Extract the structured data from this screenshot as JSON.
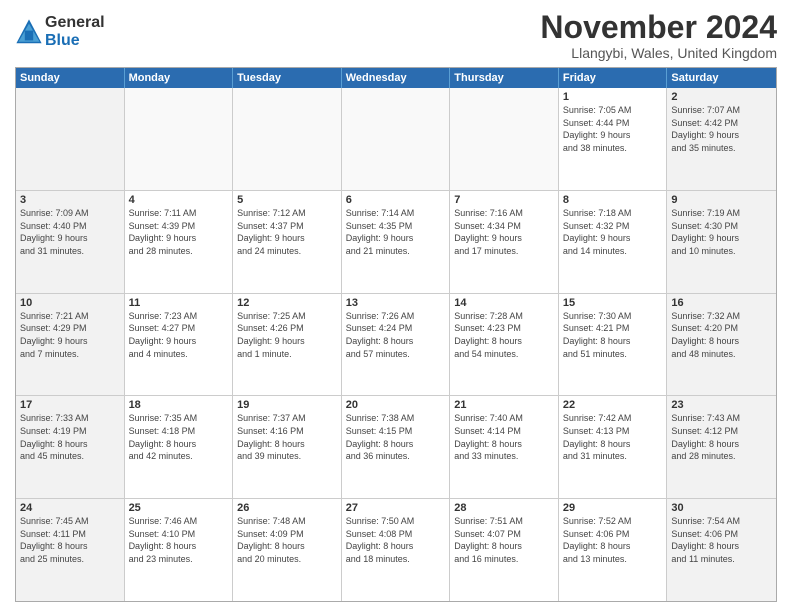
{
  "logo": {
    "general": "General",
    "blue": "Blue"
  },
  "title": "November 2024",
  "location": "Llangybi, Wales, United Kingdom",
  "header_days": [
    "Sunday",
    "Monday",
    "Tuesday",
    "Wednesday",
    "Thursday",
    "Friday",
    "Saturday"
  ],
  "weeks": [
    [
      {
        "day": "",
        "info": ""
      },
      {
        "day": "",
        "info": ""
      },
      {
        "day": "",
        "info": ""
      },
      {
        "day": "",
        "info": ""
      },
      {
        "day": "",
        "info": ""
      },
      {
        "day": "1",
        "info": "Sunrise: 7:05 AM\nSunset: 4:44 PM\nDaylight: 9 hours\nand 38 minutes."
      },
      {
        "day": "2",
        "info": "Sunrise: 7:07 AM\nSunset: 4:42 PM\nDaylight: 9 hours\nand 35 minutes."
      }
    ],
    [
      {
        "day": "3",
        "info": "Sunrise: 7:09 AM\nSunset: 4:40 PM\nDaylight: 9 hours\nand 31 minutes."
      },
      {
        "day": "4",
        "info": "Sunrise: 7:11 AM\nSunset: 4:39 PM\nDaylight: 9 hours\nand 28 minutes."
      },
      {
        "day": "5",
        "info": "Sunrise: 7:12 AM\nSunset: 4:37 PM\nDaylight: 9 hours\nand 24 minutes."
      },
      {
        "day": "6",
        "info": "Sunrise: 7:14 AM\nSunset: 4:35 PM\nDaylight: 9 hours\nand 21 minutes."
      },
      {
        "day": "7",
        "info": "Sunrise: 7:16 AM\nSunset: 4:34 PM\nDaylight: 9 hours\nand 17 minutes."
      },
      {
        "day": "8",
        "info": "Sunrise: 7:18 AM\nSunset: 4:32 PM\nDaylight: 9 hours\nand 14 minutes."
      },
      {
        "day": "9",
        "info": "Sunrise: 7:19 AM\nSunset: 4:30 PM\nDaylight: 9 hours\nand 10 minutes."
      }
    ],
    [
      {
        "day": "10",
        "info": "Sunrise: 7:21 AM\nSunset: 4:29 PM\nDaylight: 9 hours\nand 7 minutes."
      },
      {
        "day": "11",
        "info": "Sunrise: 7:23 AM\nSunset: 4:27 PM\nDaylight: 9 hours\nand 4 minutes."
      },
      {
        "day": "12",
        "info": "Sunrise: 7:25 AM\nSunset: 4:26 PM\nDaylight: 9 hours\nand 1 minute."
      },
      {
        "day": "13",
        "info": "Sunrise: 7:26 AM\nSunset: 4:24 PM\nDaylight: 8 hours\nand 57 minutes."
      },
      {
        "day": "14",
        "info": "Sunrise: 7:28 AM\nSunset: 4:23 PM\nDaylight: 8 hours\nand 54 minutes."
      },
      {
        "day": "15",
        "info": "Sunrise: 7:30 AM\nSunset: 4:21 PM\nDaylight: 8 hours\nand 51 minutes."
      },
      {
        "day": "16",
        "info": "Sunrise: 7:32 AM\nSunset: 4:20 PM\nDaylight: 8 hours\nand 48 minutes."
      }
    ],
    [
      {
        "day": "17",
        "info": "Sunrise: 7:33 AM\nSunset: 4:19 PM\nDaylight: 8 hours\nand 45 minutes."
      },
      {
        "day": "18",
        "info": "Sunrise: 7:35 AM\nSunset: 4:18 PM\nDaylight: 8 hours\nand 42 minutes."
      },
      {
        "day": "19",
        "info": "Sunrise: 7:37 AM\nSunset: 4:16 PM\nDaylight: 8 hours\nand 39 minutes."
      },
      {
        "day": "20",
        "info": "Sunrise: 7:38 AM\nSunset: 4:15 PM\nDaylight: 8 hours\nand 36 minutes."
      },
      {
        "day": "21",
        "info": "Sunrise: 7:40 AM\nSunset: 4:14 PM\nDaylight: 8 hours\nand 33 minutes."
      },
      {
        "day": "22",
        "info": "Sunrise: 7:42 AM\nSunset: 4:13 PM\nDaylight: 8 hours\nand 31 minutes."
      },
      {
        "day": "23",
        "info": "Sunrise: 7:43 AM\nSunset: 4:12 PM\nDaylight: 8 hours\nand 28 minutes."
      }
    ],
    [
      {
        "day": "24",
        "info": "Sunrise: 7:45 AM\nSunset: 4:11 PM\nDaylight: 8 hours\nand 25 minutes."
      },
      {
        "day": "25",
        "info": "Sunrise: 7:46 AM\nSunset: 4:10 PM\nDaylight: 8 hours\nand 23 minutes."
      },
      {
        "day": "26",
        "info": "Sunrise: 7:48 AM\nSunset: 4:09 PM\nDaylight: 8 hours\nand 20 minutes."
      },
      {
        "day": "27",
        "info": "Sunrise: 7:50 AM\nSunset: 4:08 PM\nDaylight: 8 hours\nand 18 minutes."
      },
      {
        "day": "28",
        "info": "Sunrise: 7:51 AM\nSunset: 4:07 PM\nDaylight: 8 hours\nand 16 minutes."
      },
      {
        "day": "29",
        "info": "Sunrise: 7:52 AM\nSunset: 4:06 PM\nDaylight: 8 hours\nand 13 minutes."
      },
      {
        "day": "30",
        "info": "Sunrise: 7:54 AM\nSunset: 4:06 PM\nDaylight: 8 hours\nand 11 minutes."
      }
    ]
  ]
}
